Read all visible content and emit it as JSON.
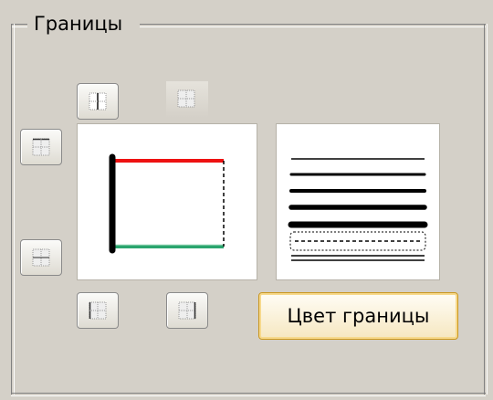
{
  "group": {
    "title": "Границы"
  },
  "color_button": {
    "label": "Цвет границы"
  },
  "icons": {
    "border_inner_vertical": "border-inner-vertical-icon",
    "border_inner_all": "border-inner-all-icon",
    "border_top": "border-top-icon",
    "border_bottom": "border-bottom-icon",
    "border_left": "border-left-icon",
    "border_right": "border-right-icon"
  },
  "preview": {
    "top_color": "#ee1111",
    "left_color": "#000000",
    "bottom_color": "#2aa56e",
    "right_style": "dashed"
  },
  "line_styles": [
    "thin",
    "medium",
    "thick",
    "thicker",
    "thickest",
    "dotted",
    "double"
  ]
}
